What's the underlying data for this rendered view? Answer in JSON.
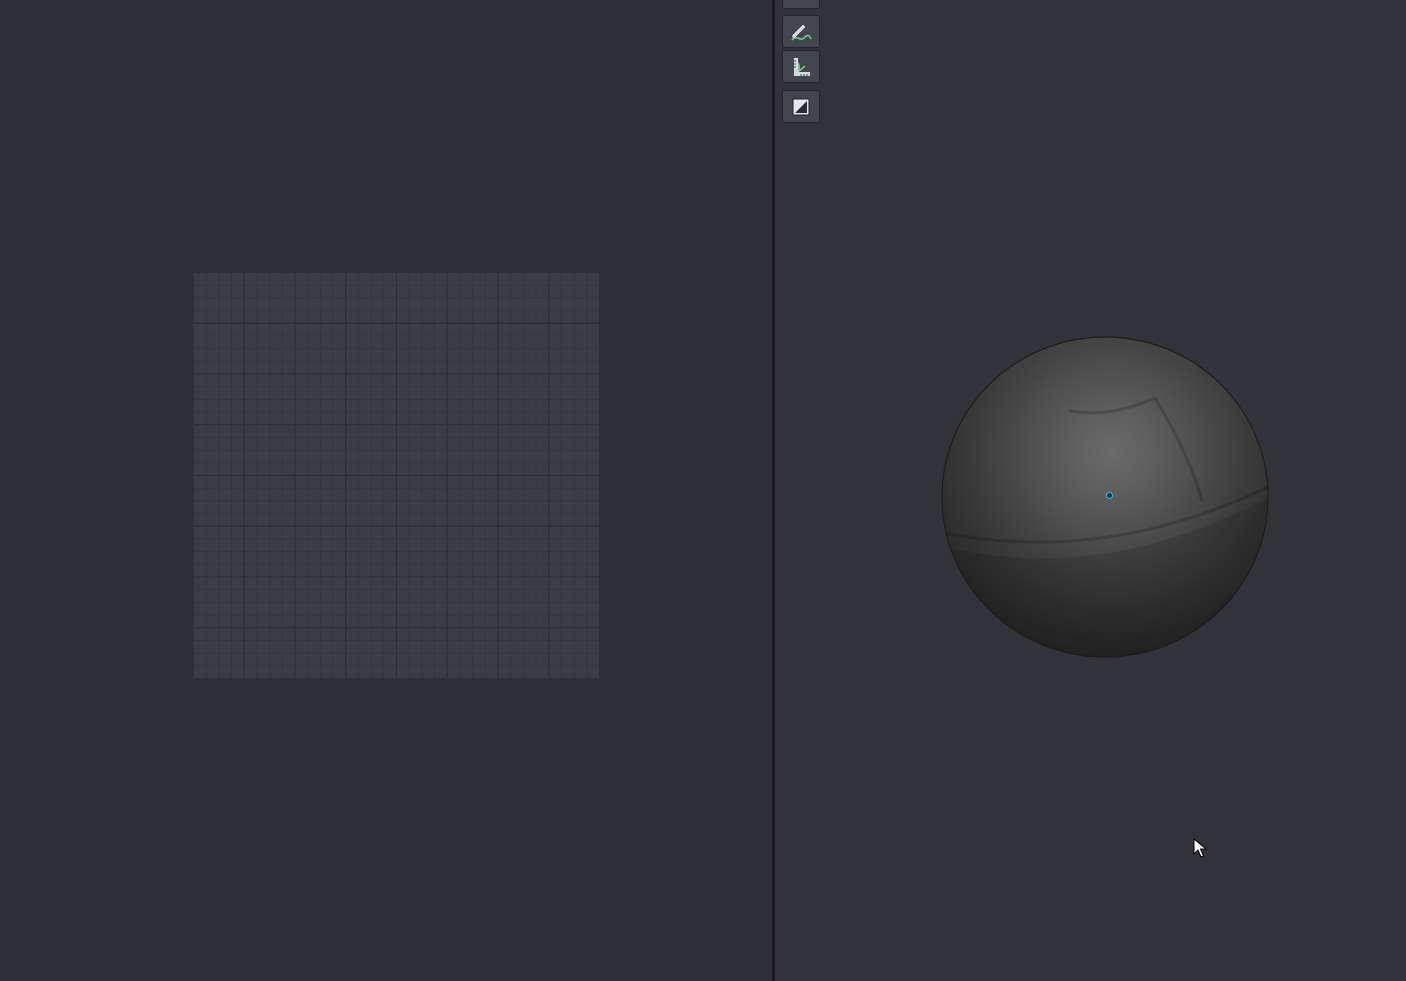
{
  "panels": {
    "left": {
      "name": "uv-editor"
    },
    "right": {
      "name": "3d-viewport"
    }
  },
  "toolbar": {
    "buttons": [
      {
        "name": "partial-tool-button",
        "icon": "partial-icon"
      },
      {
        "name": "draw-curve-button",
        "icon": "pencil-curve-icon"
      },
      {
        "name": "measure-button",
        "icon": "ruler-angle-icon"
      },
      {
        "name": "display-toggle-button",
        "icon": "half-shade-square-icon"
      }
    ]
  },
  "colors": {
    "background": "#2f3035",
    "grid": "#3b3d42",
    "accent_pivot": "#1ec8f0",
    "icon_green": "#7fd6a6"
  }
}
